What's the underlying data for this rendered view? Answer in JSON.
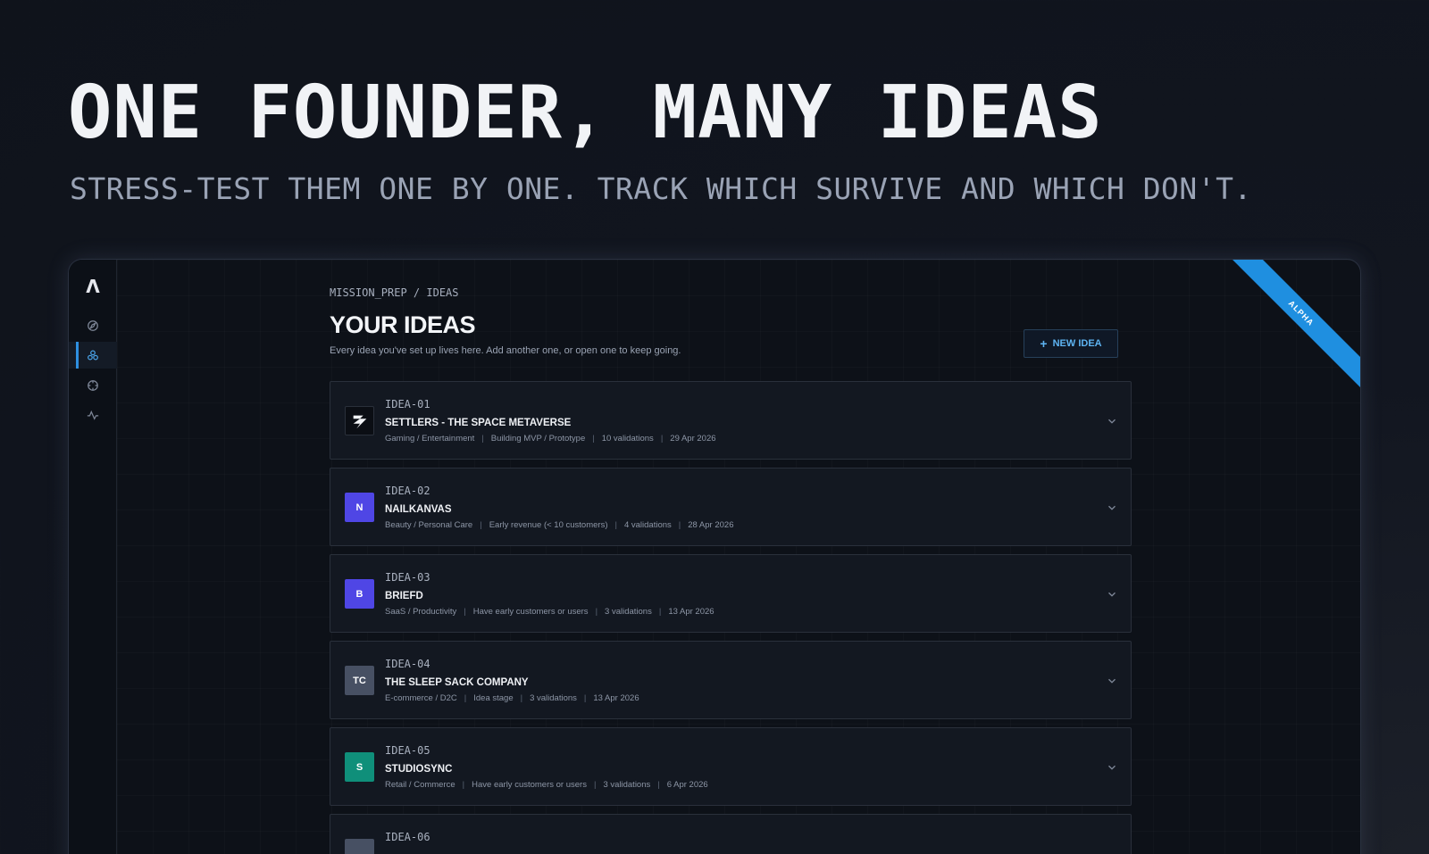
{
  "hero": {
    "title": "ONE FOUNDER, MANY IDEAS",
    "subtitle": "STRESS-TEST THEM ONE BY ONE. TRACK WHICH SURVIVE AND WHICH DON'T."
  },
  "app": {
    "logo": "Λ",
    "ribbon": "ALPHA",
    "breadcrumb": "MISSION_PREP / IDEAS",
    "page_title": "YOUR IDEAS",
    "page_description": "Every idea you've set up lives here. Add another one, or open one to keep going.",
    "new_idea_label": "NEW IDEA",
    "sidebar": [
      {
        "icon": "compass-icon",
        "active": false
      },
      {
        "icon": "ideas-icon",
        "active": true
      },
      {
        "icon": "target-icon",
        "active": false
      },
      {
        "icon": "activity-icon",
        "active": false
      }
    ],
    "ideas": [
      {
        "id": "IDEA-01",
        "name": "SETTLERS - THE SPACE METAVERSE",
        "avatar": "logo",
        "avatar_color": "#0b0e14",
        "category": "Gaming / Entertainment",
        "stage": "Building MVP / Prototype",
        "validations": "10 validations",
        "date": "29 Apr 2026"
      },
      {
        "id": "IDEA-02",
        "name": "NAILKANVAS",
        "avatar": "N",
        "avatar_color": "#4f46e5",
        "category": "Beauty / Personal Care",
        "stage": "Early revenue (< 10 customers)",
        "validations": "4 validations",
        "date": "28 Apr 2026"
      },
      {
        "id": "IDEA-03",
        "name": "BRIEFD",
        "avatar": "B",
        "avatar_color": "#4f46e5",
        "category": "SaaS / Productivity",
        "stage": "Have early customers or users",
        "validations": "3 validations",
        "date": "13 Apr 2026"
      },
      {
        "id": "IDEA-04",
        "name": "THE SLEEP SACK COMPANY",
        "avatar": "TC",
        "avatar_color": "#475063",
        "category": "E-commerce / D2C",
        "stage": "Idea stage",
        "validations": "3 validations",
        "date": "13 Apr 2026"
      },
      {
        "id": "IDEA-05",
        "name": "STUDIOSYNC",
        "avatar": "S",
        "avatar_color": "#0f8f7a",
        "category": "Retail / Commerce",
        "stage": "Have early customers or users",
        "validations": "3 validations",
        "date": "6 Apr 2026"
      },
      {
        "id": "IDEA-06",
        "name": "",
        "avatar": "",
        "avatar_color": "#475063",
        "category": "",
        "stage": "",
        "validations": "",
        "date": ""
      }
    ]
  }
}
